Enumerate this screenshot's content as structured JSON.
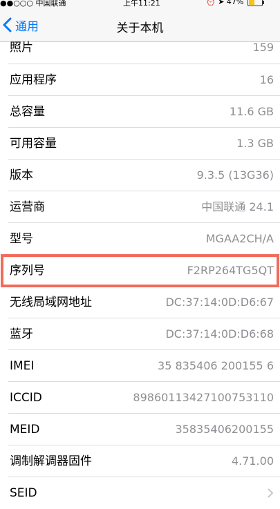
{
  "status_bar": {
    "carrier": "●●○○○ 中国联通",
    "time": "上午11:21",
    "battery_text": "47%"
  },
  "nav": {
    "back_label": "通用",
    "title": "关于本机"
  },
  "rows": [
    {
      "label": "照片",
      "value": "159"
    },
    {
      "label": "应用程序",
      "value": "16"
    },
    {
      "label": "总容量",
      "value": "11.6 GB"
    },
    {
      "label": "可用容量",
      "value": "1.3 GB"
    },
    {
      "label": "版本",
      "value": "9.3.5 (13G36)"
    },
    {
      "label": "运营商",
      "value": "中国联通 24.1"
    },
    {
      "label": "型号",
      "value": "MGAA2CH/A"
    },
    {
      "label": "序列号",
      "value": "F2RP264TG5QT"
    },
    {
      "label": "无线局域网地址",
      "value": "DC:37:14:0D:D6:67"
    },
    {
      "label": "蓝牙",
      "value": "DC:37:14:0D:D6:68"
    },
    {
      "label": "IMEI",
      "value": "35 835406 200155 6"
    },
    {
      "label": "ICCID",
      "value": "89860113427100753110"
    },
    {
      "label": "MEID",
      "value": "35835406200155"
    },
    {
      "label": "调制解调器固件",
      "value": "4.71.00"
    },
    {
      "label": "SEID",
      "value": ""
    }
  ],
  "colors": {
    "accent": "#007aff",
    "highlight_border": "#f26a5b",
    "value_text": "#8e8e93"
  }
}
